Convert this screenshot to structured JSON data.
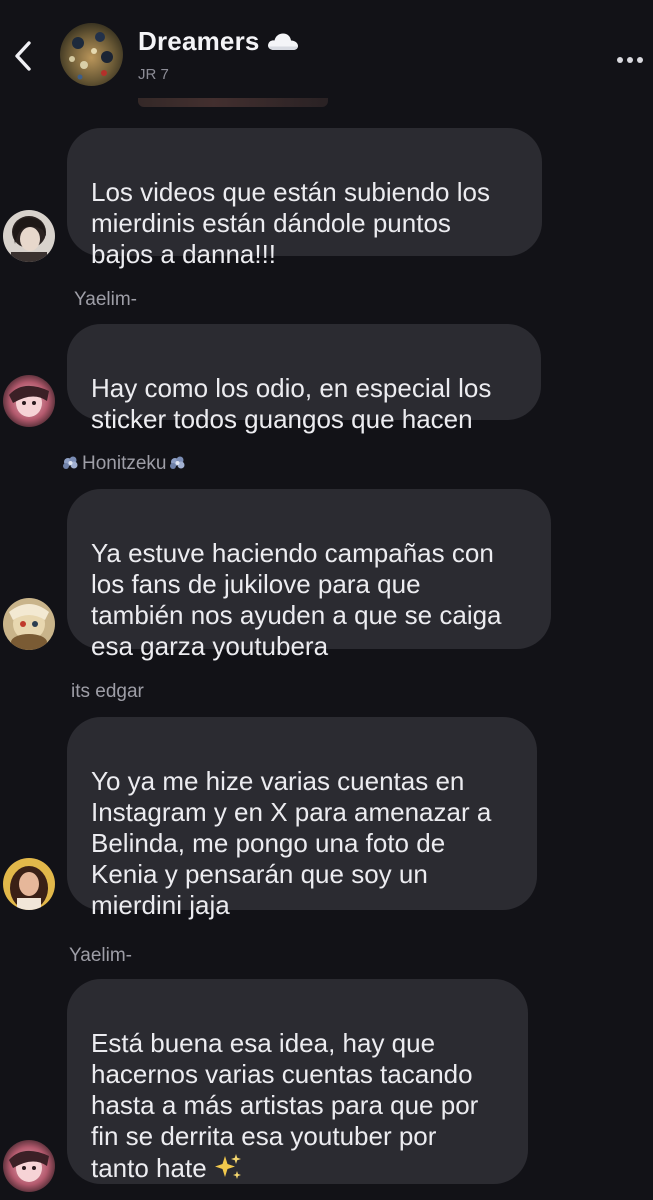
{
  "header": {
    "title": "Dreamers",
    "subtitle": "JR 7",
    "title_icon": "cloud-icon",
    "back_icon": "chevron-left-icon",
    "more_icon": "more-dots-icon"
  },
  "messages": [
    {
      "sender": "",
      "text": "Los videos que están subiendo los\nmierdinis están dándole puntos\nbajos a danna!!!"
    },
    {
      "sender": "Yaelim-",
      "text": "Hay como los odio, en especial los\nsticker todos guangos que hacen"
    },
    {
      "sender": "Honitzeku",
      "sender_decoration": "flower-icon",
      "text": "Ya estuve haciendo campañas con\nlos fans de jukilove para que\ntambién nos ayuden a que se caiga\nesa garza youtubera"
    },
    {
      "sender": "its edgar",
      "text": "Yo ya me hize varias cuentas en\nInstagram y en X para amenazar a\nBelinda, me pongo una foto de\nKenia y pensarán que soy un\nmierdini jaja"
    },
    {
      "sender": "Yaelim-",
      "text": "Está buena esa idea, hay que\nhacernos varias cuentas tacando\nhasta a más artistas para que por\nfin se derrita esa youtuber por\ntanto hate",
      "trailing_icon": "sparkles-icon"
    }
  ],
  "colors": {
    "background": "#121217",
    "bubble": "#2b2b31",
    "text": "#ececf0",
    "sender": "#9e9ea7",
    "sparkle": "#f2c94c"
  }
}
